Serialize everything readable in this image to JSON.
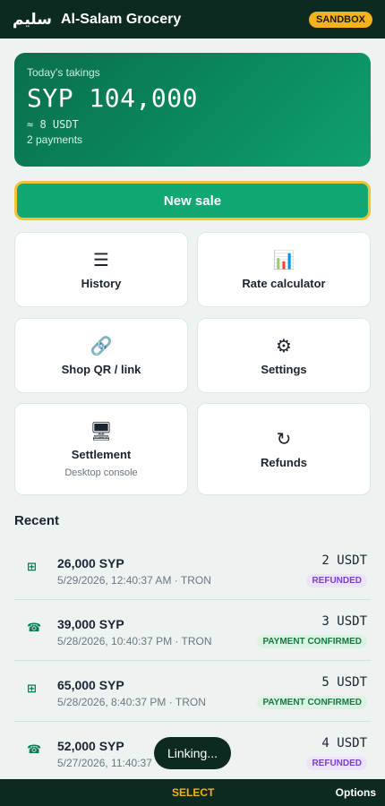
{
  "header": {
    "logo_text": "سليم",
    "shop_name": "Al-Salam Grocery",
    "mode_badge": "SANDBOX"
  },
  "takings": {
    "label": "Today's takings",
    "amount": "SYP 104,000",
    "usdt": "≈ 8 USDT",
    "count": "2 payments"
  },
  "new_sale_label": "New sale",
  "tiles": [
    {
      "icon": "☰",
      "icon_name": "menu-list-icon",
      "label": "History"
    },
    {
      "icon": "📊",
      "icon_name": "bar-chart-icon",
      "label": "Rate calculator"
    },
    {
      "icon": "🔗",
      "icon_name": "link-icon",
      "label": "Shop QR / link"
    },
    {
      "icon": "⚙",
      "icon_name": "gear-icon",
      "label": "Settings"
    },
    {
      "icon": "🖥",
      "icon_name": "desktop-icon",
      "label": "Settlement",
      "sub": "Desktop console"
    },
    {
      "icon": "↻",
      "icon_name": "refund-icon",
      "label": "Refunds"
    }
  ],
  "recent_title": "Recent",
  "recent": [
    {
      "icon": "⊞",
      "icon_name": "qr-icon",
      "amount": "26,000 SYP",
      "meta": "5/29/2026, 12:40:37 AM · TRON",
      "usdt": "2 USDT",
      "status": "REFUNDED"
    },
    {
      "icon": "☎",
      "icon_name": "phone-icon",
      "amount": "39,000 SYP",
      "meta": "5/28/2026, 10:40:37 PM · TRON",
      "usdt": "3 USDT",
      "status": "PAYMENT CONFIRMED"
    },
    {
      "icon": "⊞",
      "icon_name": "qr-icon",
      "amount": "65,000 SYP",
      "meta": "5/28/2026, 8:40:37 PM · TRON",
      "usdt": "5 USDT",
      "status": "PAYMENT CONFIRMED"
    },
    {
      "icon": "☎",
      "icon_name": "phone-icon",
      "amount": "52,000 SYP",
      "meta": "5/27/2026, 11:40:37",
      "usdt": "4 USDT",
      "status": "REFUNDED"
    }
  ],
  "toast": "Linking...",
  "softkeys": {
    "select": "SELECT",
    "options": "Options"
  },
  "colors": {
    "header_bg": "#0c2a20",
    "accent_green": "#0fa873",
    "sandbox_yellow": "#f5b21a",
    "refunded_purple": "#7b3fd0",
    "confirmed_green": "#16793f"
  }
}
